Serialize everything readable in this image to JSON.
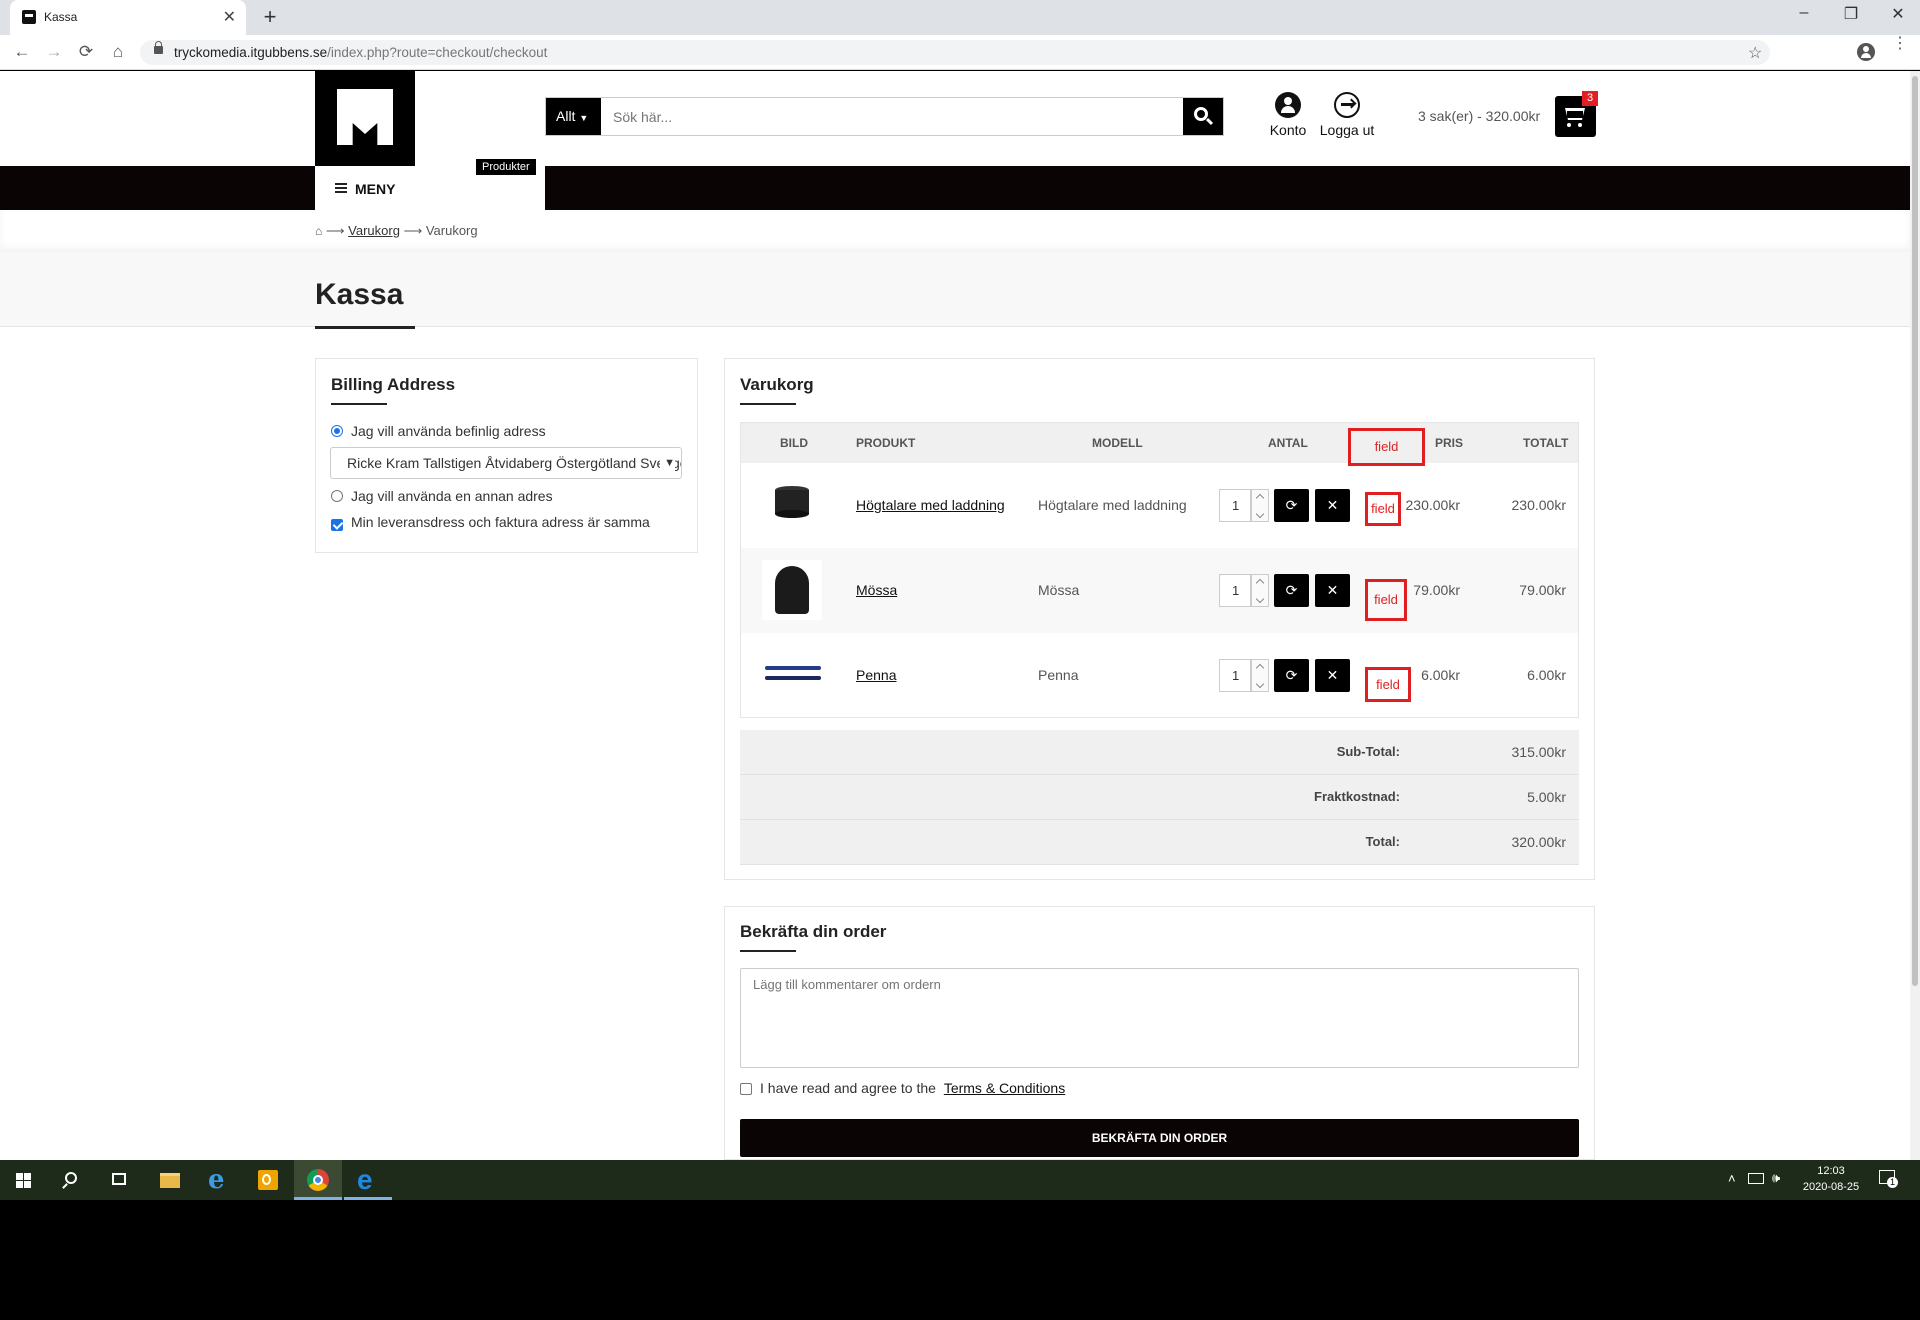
{
  "browser": {
    "tab_title": "Kassa",
    "new_tab": "+",
    "window_controls": [
      "–",
      "❐",
      "✕"
    ],
    "url_host": "tryckomedia.itgubbens.se",
    "url_path": "/index.php?route=checkout/checkout",
    "nav": [
      "←",
      "→",
      "⟳",
      "⌂"
    ]
  },
  "header": {
    "search_category": "Allt",
    "search_placeholder": "Sök här...",
    "account_label": "Konto",
    "logout_label": "Logga ut",
    "cart_summary": "3 sak(er) - 320.00kr",
    "cart_count": "3",
    "menu_label": "MENY",
    "products_tag": "Produkter"
  },
  "breadcrumb": {
    "sep": "⟶",
    "items": [
      "Varukorg",
      "Varukorg"
    ]
  },
  "page_title": "Kassa",
  "billing": {
    "title": "Billing Address",
    "option_existing": "Jag vill använda befinlig adress",
    "selected_address": "Ricke Kram Tallstigen Åtvidaberg Östergötland Sverige",
    "option_new": "Jag vill använda en annan adres",
    "same_address": "Min leveransdress och faktura adress är samma"
  },
  "cart": {
    "title": "Varukorg",
    "headers": {
      "image": "BILD",
      "product": "PRODUKT",
      "model": "MODELL",
      "qty": "ANTAL",
      "field": "field",
      "price": "PRIS",
      "total": "TOTALT"
    },
    "rows": [
      {
        "name": "Högtalare med laddning",
        "model": "Högtalare med laddning",
        "qty": "1",
        "field": "field",
        "price": "230.00kr",
        "total": "230.00kr"
      },
      {
        "name": "Mössa",
        "model": "Mössa",
        "qty": "1",
        "field": "field",
        "price": "79.00kr",
        "total": "79.00kr"
      },
      {
        "name": "Penna",
        "model": "Penna",
        "qty": "1",
        "field": "field",
        "price": "6.00kr",
        "total": "6.00kr"
      }
    ],
    "refresh_icon": "⟳",
    "remove_icon": "✕",
    "totals": [
      {
        "label": "Sub-Total:",
        "value": "315.00kr"
      },
      {
        "label": "Fraktkostnad:",
        "value": "5.00kr"
      },
      {
        "label": "Total:",
        "value": "320.00kr"
      }
    ]
  },
  "confirm": {
    "title": "Bekräfta din order",
    "comment_placeholder": "Lägg till kommentarer om ordern",
    "agree_text": "I have read and agree to the",
    "terms_link": "Terms & Conditions",
    "button": "BEKRÄFTA DIN ORDER"
  },
  "taskbar": {
    "time": "12:03",
    "date": "2020-08-25",
    "notifications": "1"
  }
}
